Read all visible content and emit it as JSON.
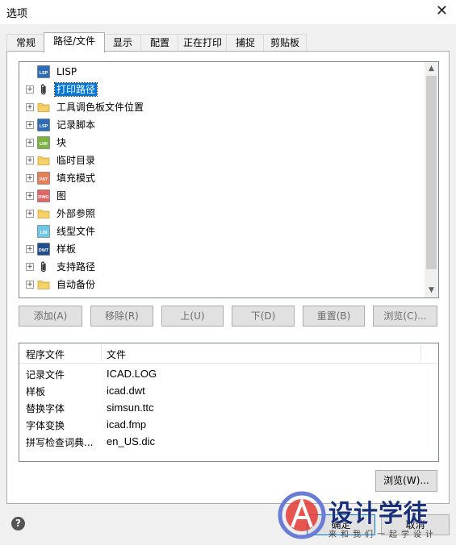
{
  "window": {
    "title": "选项",
    "close_glyph": "✕"
  },
  "tabs": [
    {
      "label": "常规"
    },
    {
      "label": "路径/文件"
    },
    {
      "label": "显示"
    },
    {
      "label": "配置"
    },
    {
      "label": "正在打印"
    },
    {
      "label": "捕捉"
    },
    {
      "label": "剪贴板"
    }
  ],
  "active_tab": "路径/文件",
  "tree": {
    "items": [
      {
        "label": "LISP",
        "icon": "lsp-file-icon",
        "badge": "LSP",
        "badge_color": "#2e6db4",
        "expandable": false
      },
      {
        "label": "打印路径",
        "icon": "paperclip-icon",
        "expandable": true,
        "selected": true
      },
      {
        "label": "工具调色板文件位置",
        "icon": "folder-icon",
        "expandable": true
      },
      {
        "label": "记录脚本",
        "icon": "lsp-file-icon",
        "badge": "LSP",
        "badge_color": "#2e6db4",
        "expandable": true
      },
      {
        "label": "块",
        "icon": "lwi-file-icon",
        "badge": "LWI",
        "badge_color": "#7cb342",
        "expandable": true
      },
      {
        "label": "临时目录",
        "icon": "folder-icon",
        "expandable": true
      },
      {
        "label": "填充模式",
        "icon": "pat-file-icon",
        "badge": "PAT",
        "badge_color": "#e67e5a",
        "expandable": true
      },
      {
        "label": "图",
        "icon": "dwg-file-icon",
        "badge": "DWG",
        "badge_color": "#e06666",
        "expandable": true
      },
      {
        "label": "外部参照",
        "icon": "folder-icon",
        "expandable": true
      },
      {
        "label": "线型文件",
        "icon": "lin-file-icon",
        "badge": "LIN",
        "badge_color": "#6ec6e8",
        "expandable": false
      },
      {
        "label": "样板",
        "icon": "dwt-file-icon",
        "badge": "DWT",
        "badge_color": "#1f4e8c",
        "expandable": true
      },
      {
        "label": "支持路径",
        "icon": "paperclip-icon",
        "expandable": true
      },
      {
        "label": "自动备份",
        "icon": "folder-icon",
        "expandable": true
      }
    ]
  },
  "buttons": {
    "add": "添加(A)",
    "remove": "移除(R)",
    "up": "上(U)",
    "down": "下(D)",
    "reset": "重置(B)",
    "browse_path": "浏览(C)..."
  },
  "listview": {
    "columns": [
      "程序文件",
      "文件"
    ],
    "rows": [
      {
        "key": "记录文件",
        "value": "ICAD.LOG"
      },
      {
        "key": "样板",
        "value": "icad.dwt"
      },
      {
        "key": "替换字体",
        "value": "simsun.ttc"
      },
      {
        "key": "字体变换",
        "value": "icad.fmp"
      },
      {
        "key": "拼写检查词典...",
        "value": "en_US.dic"
      }
    ]
  },
  "browse_button": "浏览(W)...",
  "help_glyph": "?",
  "ok_button": "确定",
  "cancel_button": "取消",
  "watermark": {
    "title": "设计学徒",
    "subtitle": "来和我们一起学设计"
  }
}
